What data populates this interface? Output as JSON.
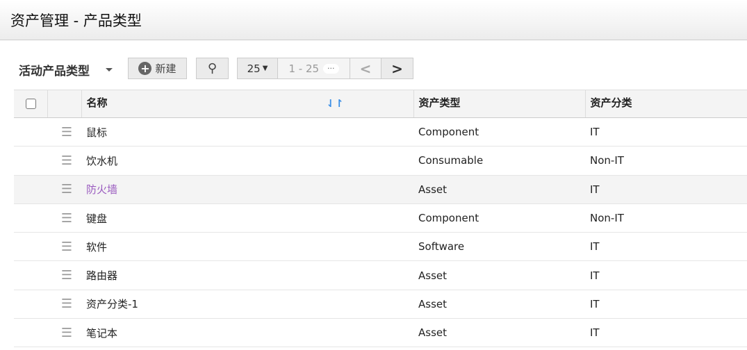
{
  "header": {
    "title": "资产管理 - 产品类型"
  },
  "toolbar": {
    "view_label": "活动产品类型",
    "new_label": "新建",
    "per_page": "25",
    "range": "1 - 25",
    "more": "···",
    "prev": "<",
    "next": ">"
  },
  "table": {
    "columns": [
      "名称",
      "资产类型",
      "资产分类"
    ],
    "rows": [
      {
        "name": "鼠标",
        "type": "Component",
        "category": "IT"
      },
      {
        "name": "饮水机",
        "type": "Consumable",
        "category": "Non-IT"
      },
      {
        "name": "防火墙",
        "type": "Asset",
        "category": "IT"
      },
      {
        "name": "键盘",
        "type": "Component",
        "category": "Non-IT"
      },
      {
        "name": "软件",
        "type": "Software",
        "category": "IT"
      },
      {
        "name": "路由器",
        "type": "Asset",
        "category": "IT"
      },
      {
        "name": "资产分类-1",
        "type": "Asset",
        "category": "IT"
      },
      {
        "name": "笔记本",
        "type": "Asset",
        "category": "IT"
      }
    ]
  }
}
